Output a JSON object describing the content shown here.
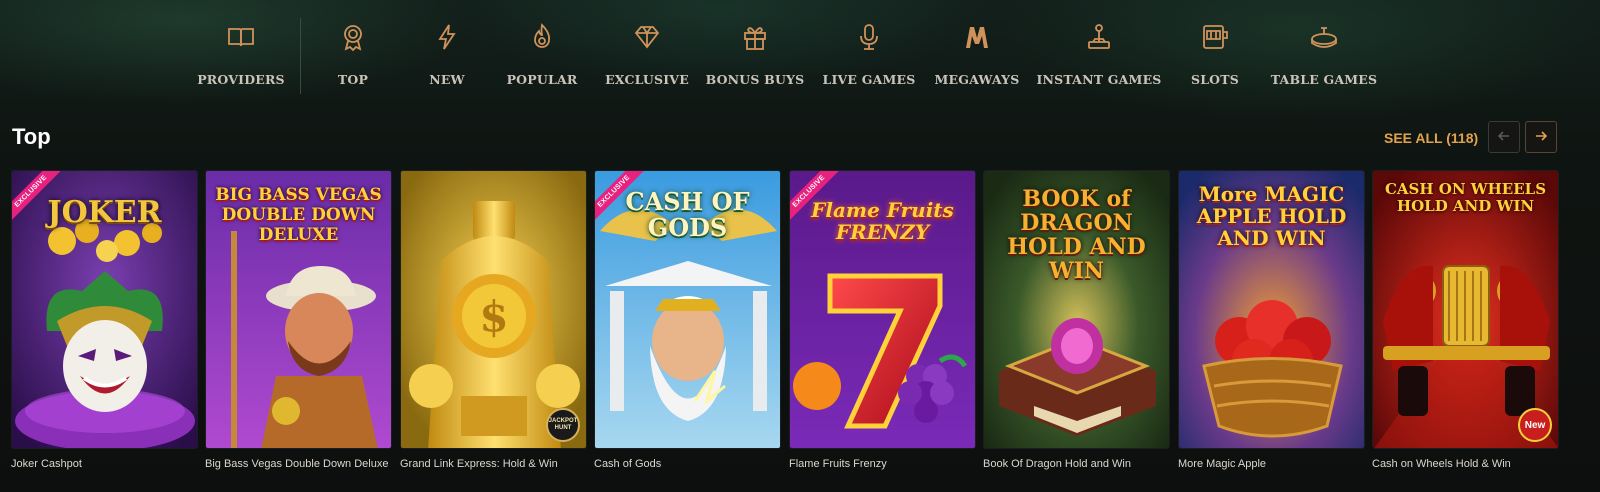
{
  "nav": {
    "items": [
      {
        "label": "PROVIDERS",
        "icon": "book-icon"
      },
      {
        "label": "TOP",
        "icon": "award-rosette-icon"
      },
      {
        "label": "NEW",
        "icon": "lightning-icon"
      },
      {
        "label": "POPULAR",
        "icon": "flame-icon"
      },
      {
        "label": "EXCLUSIVE",
        "icon": "diamond-icon"
      },
      {
        "label": "BONUS BUYS",
        "icon": "gift-icon"
      },
      {
        "label": "LIVE GAMES",
        "icon": "microphone-icon"
      },
      {
        "label": "MEGAWAYS",
        "icon": "megaways-m-icon"
      },
      {
        "label": "INSTANT GAMES",
        "icon": "joystick-icon"
      },
      {
        "label": "SLOTS",
        "icon": "slot-machine-icon"
      },
      {
        "label": "TABLE GAMES",
        "icon": "roulette-table-icon"
      }
    ],
    "icon_color": "#d0925a"
  },
  "section": {
    "title": "Top",
    "see_all": "SEE ALL (118)",
    "prev_icon": "arrow-left-icon",
    "next_icon": "arrow-right-icon"
  },
  "games": [
    {
      "title": "Joker Cashpot",
      "badge": "EXCLUSIVE",
      "logo": "JOKER",
      "theme": "joker"
    },
    {
      "title": "Big Bass Vegas Double Down Deluxe",
      "badge": "",
      "logo": "BIG BASS VEGAS DOUBLE DOWN DELUXE",
      "theme": "bigbass"
    },
    {
      "title": "Grand Link Express: Hold & Win",
      "badge": "",
      "logo": "",
      "corner_badge": "JACKPOT HUNT",
      "theme": "train"
    },
    {
      "title": "Cash of Gods",
      "badge": "EXCLUSIVE",
      "logo": "CASH OF GODS",
      "theme": "gods"
    },
    {
      "title": "Flame Fruits Frenzy",
      "badge": "EXCLUSIVE",
      "logo": "Flame Fruits FRENZY",
      "theme": "flame"
    },
    {
      "title": "Book Of Dragon Hold and Win",
      "badge": "",
      "logo": "BOOK of DRAGON HOLD AND WIN",
      "theme": "dragon"
    },
    {
      "title": "More Magic Apple",
      "badge": "",
      "logo": "More MAGIC APPLE HOLD AND WIN",
      "theme": "apple"
    },
    {
      "title": "Cash on Wheels Hold & Win",
      "badge": "",
      "logo": "CASH ON WHEELS HOLD AND WIN",
      "corner_badge": "New",
      "theme": "wheels"
    }
  ],
  "colors": {
    "accent": "#e3a24c",
    "exclusive_ribbon": "#e8217f",
    "background": "#101815"
  }
}
